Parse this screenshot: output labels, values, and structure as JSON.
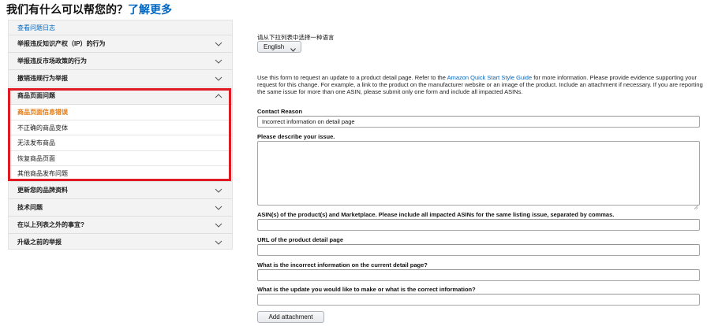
{
  "header": {
    "title": "我们有什么可以帮您的？",
    "learn_more": "了解更多"
  },
  "sidebar": {
    "view_log": "查看问题日志",
    "sections": [
      {
        "label": "举报违反知识产权（IP）的行为",
        "expanded": false
      },
      {
        "label": "举报违反市场政策的行为",
        "expanded": false
      },
      {
        "label": "撤销违规行为举报",
        "expanded": false
      },
      {
        "label": "商品页面问题",
        "expanded": true
      },
      {
        "label": "更新您的品牌资料",
        "expanded": false
      },
      {
        "label": "技术问题",
        "expanded": false
      },
      {
        "label": "在以上列表之外的事宜?",
        "expanded": false
      },
      {
        "label": "升级之前的举报",
        "expanded": false
      }
    ],
    "subitems": [
      {
        "label": "商品页面信息错误",
        "active": true
      },
      {
        "label": "不正确的商品变体",
        "active": false
      },
      {
        "label": "无法发布商品",
        "active": false
      },
      {
        "label": "恢复商品页面",
        "active": false
      },
      {
        "label": "其他商品发布问题",
        "active": false
      }
    ]
  },
  "form": {
    "language_prompt": "请从下拉列表中选择一种语言",
    "language_value": "English",
    "intro_before_link": "Use this form to request an update to a product detail page. Refer to the ",
    "intro_link": "Amazon Quick Start Style Guide",
    "intro_after_link": " for more information. Please provide evidence supporting your request for this change. For example, a link to the product on the manufacturer website or an image of the product. Include an attachment if necessary. If you are reporting the same issue for more than one ASIN, please submit only one form and include all impacted ASINs.",
    "contact_reason_label": "Contact Reason",
    "contact_reason_value": "Incorrect information on detail page",
    "describe_label": "Please describe your issue.",
    "asin_label": "ASIN(s) of the product(s) and Marketplace. Please include all impacted ASINs for the same listing issue, separated by commas.",
    "url_label": "URL of the product detail page",
    "incorrect_info_label": "What is the incorrect information on the current detail page?",
    "update_label": "What is the update you would like to make or what is the correct information?",
    "attachment_button": "Add attachment"
  },
  "colors": {
    "link": "#0066c0",
    "active_subitem": "#e47911",
    "highlight_border": "#e01b24"
  }
}
